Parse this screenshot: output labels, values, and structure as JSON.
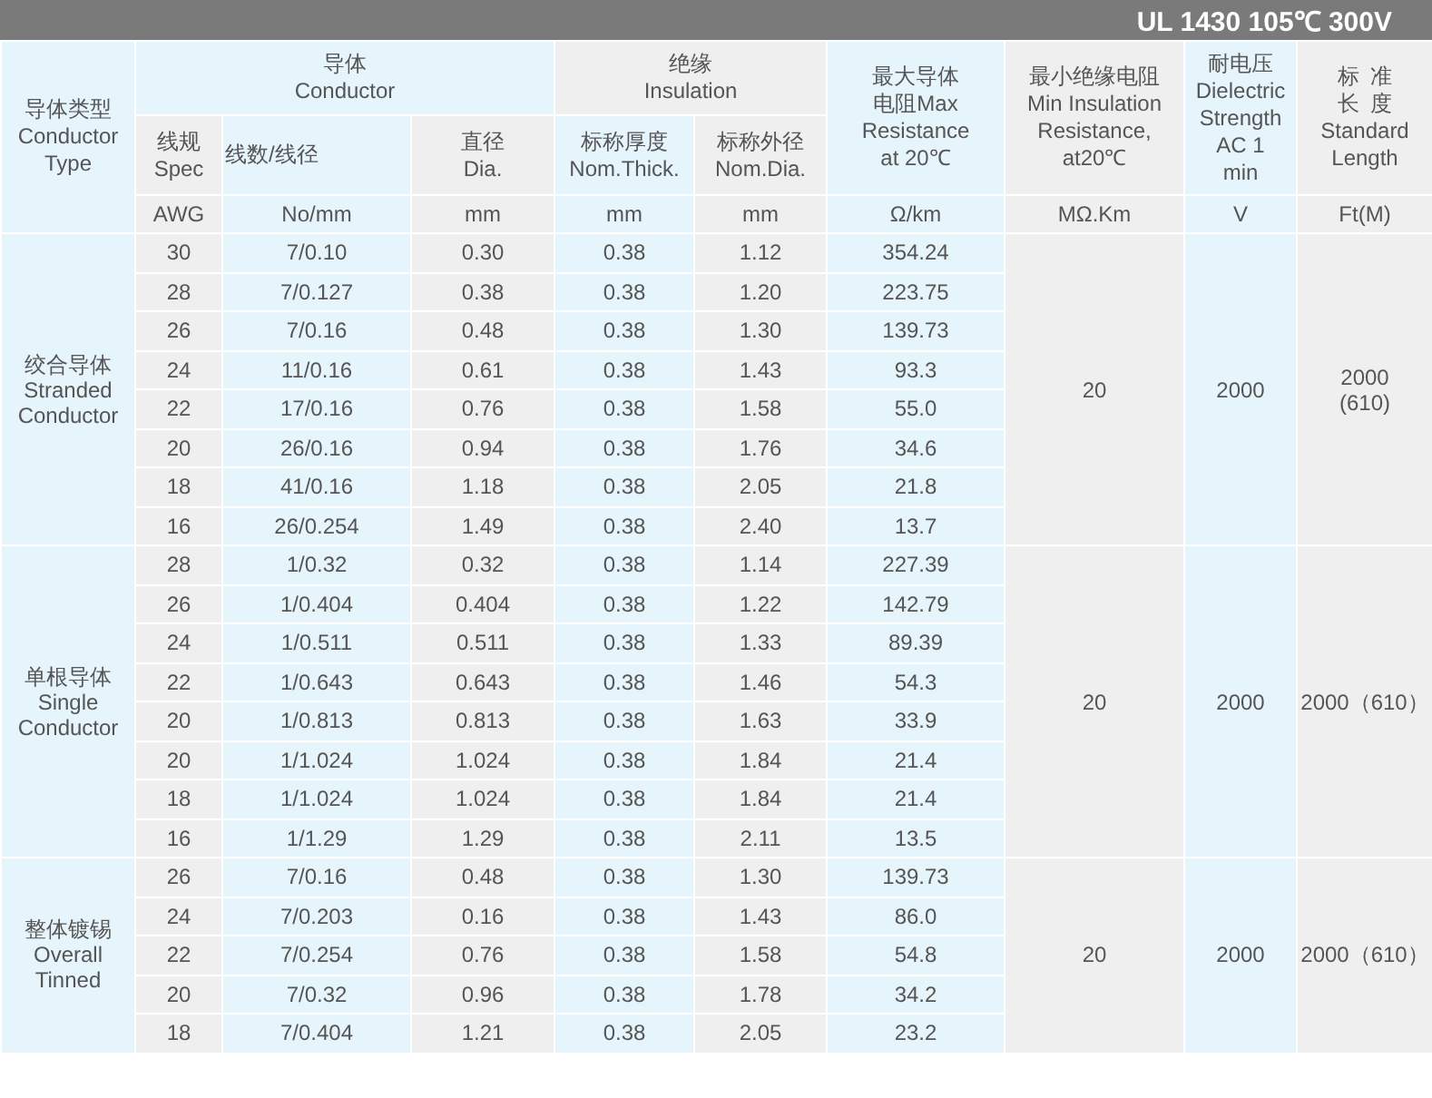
{
  "title": "UL 1430 105℃ 300V",
  "header": {
    "conductor_type": "导体类型\nConductor\nType",
    "conductor": "导体\nConductor",
    "insulation": "绝缘\nInsulation",
    "max_resistance": "最大导体电阻Max\nResistance\nat 20℃",
    "min_insulation": "最小绝缘电阻\nMin Insulation\nResistance,\nat20℃",
    "dielectric": "耐电压\nDielectric\nStrength\nAC 1\nmin",
    "standard_length": {
      "zh": "标准长度",
      "en": "Standard\nLength"
    },
    "sub": [
      "线规\nSpec",
      "线数/线径",
      "直径\nDia.",
      "标称厚度\nNom.Thick.",
      "标称外径\nNom.Dia."
    ],
    "units": [
      "AWG",
      "No/mm",
      "mm",
      "mm",
      "mm",
      "Ω/km",
      "MΩ.Km",
      "V",
      "Ft(M)"
    ]
  },
  "groups": [
    {
      "type": "绞合导体\nStranded\nConductor",
      "min_insulation": "20",
      "dielectric": "2000",
      "length": "2000\n(610)",
      "rows": [
        [
          "30",
          "7/0.10",
          "0.30",
          "0.38",
          "1.12",
          "354.24"
        ],
        [
          "28",
          "7/0.127",
          "0.38",
          "0.38",
          "1.20",
          "223.75"
        ],
        [
          "26",
          "7/0.16",
          "0.48",
          "0.38",
          "1.30",
          "139.73"
        ],
        [
          "24",
          "11/0.16",
          "0.61",
          "0.38",
          "1.43",
          "93.3"
        ],
        [
          "22",
          "17/0.16",
          "0.76",
          "0.38",
          "1.58",
          "55.0"
        ],
        [
          "20",
          "26/0.16",
          "0.94",
          "0.38",
          "1.76",
          "34.6"
        ],
        [
          "18",
          "41/0.16",
          "1.18",
          "0.38",
          "2.05",
          "21.8"
        ],
        [
          "16",
          "26/0.254",
          "1.49",
          "0.38",
          "2.40",
          "13.7"
        ]
      ]
    },
    {
      "type": "单根导体Single\nConductor",
      "min_insulation": "20",
      "dielectric": "2000",
      "length": "2000（610）",
      "rows": [
        [
          "28",
          "1/0.32",
          "0.32",
          "0.38",
          "1.14",
          "227.39"
        ],
        [
          "26",
          "1/0.404",
          "0.404",
          "0.38",
          "1.22",
          "142.79"
        ],
        [
          "24",
          "1/0.511",
          "0.511",
          "0.38",
          "1.33",
          "89.39"
        ],
        [
          "22",
          "1/0.643",
          "0.643",
          "0.38",
          "1.46",
          "54.3"
        ],
        [
          "20",
          "1/0.813",
          "0.813",
          "0.38",
          "1.63",
          "33.9"
        ],
        [
          "20",
          "1/1.024",
          "1.024",
          "0.38",
          "1.84",
          "21.4"
        ],
        [
          "18",
          "1/1.024",
          "1.024",
          "0.38",
          "1.84",
          "21.4"
        ],
        [
          "16",
          "1/1.29",
          "1.29",
          "0.38",
          "2.11",
          "13.5"
        ]
      ]
    },
    {
      "type": "整体镀锡\nOverall\nTinned",
      "min_insulation": "20",
      "dielectric": "2000",
      "length": "2000（610）",
      "rows": [
        [
          "26",
          "7/0.16",
          "0.48",
          "0.38",
          "1.30",
          "139.73"
        ],
        [
          "24",
          "7/0.203",
          "0.16",
          "0.38",
          "1.43",
          "86.0"
        ],
        [
          "22",
          "7/0.254",
          "0.76",
          "0.38",
          "1.58",
          "54.8"
        ],
        [
          "20",
          "7/0.32",
          "0.96",
          "0.38",
          "1.78",
          "34.2"
        ],
        [
          "18",
          "7/0.404",
          "1.21",
          "0.38",
          "2.05",
          "23.2"
        ]
      ]
    }
  ]
}
